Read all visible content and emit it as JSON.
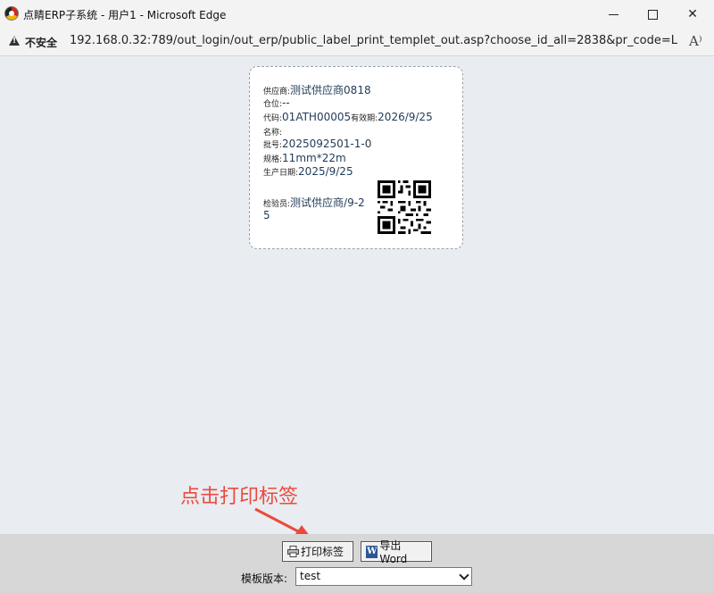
{
  "window": {
    "title": "点睛ERP子系统 - 用户1 - Microsoft Edge",
    "min_icon": "minimize-icon",
    "max_icon": "maximize-icon",
    "close_glyph": "✕"
  },
  "address": {
    "security": "不安全",
    "url": "192.168.0.32:789/out_login/out_erp/public_label_print_templet_out.asp?choose_id_all=2838&pr_code=LPM1...",
    "reader_glyph": "A⁾"
  },
  "label": {
    "supplier_key": "供应商:",
    "supplier_val": "测试供应商0818",
    "location_key": "仓位:",
    "location_val": "--",
    "code_key": "代码:",
    "code_val": "01ATH00005",
    "expiry_key": "有效期:",
    "expiry_val": "2026/9/25",
    "name_key": "名称:",
    "name_val": "",
    "batch_key": "批号:",
    "batch_val": "2025092501-1-0",
    "spec_key": "规格:",
    "spec_val": "11mm*22m",
    "mfg_key": "生产日期:",
    "mfg_val": "2025/9/25",
    "inspector_key": "检验员:",
    "inspector_val1": "测试供应商/9-2",
    "inspector_val2": "5"
  },
  "toolbar": {
    "print_label": "打印标签",
    "word_label": "导出Word",
    "word_icon_glyph": "W",
    "template_label": "模板版本:",
    "template_value": "test"
  },
  "annotation": {
    "text": "点击打印标签",
    "color": "#ea4b3c"
  }
}
